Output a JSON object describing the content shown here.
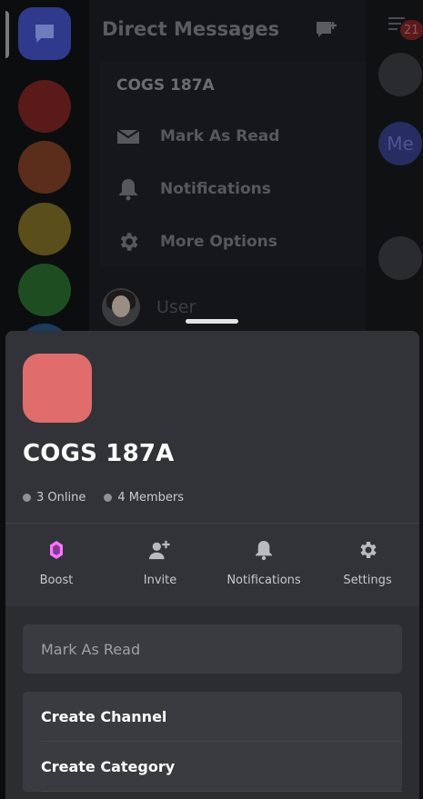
{
  "background": {
    "dm_title": "Direct Messages",
    "unread_badge": "21",
    "context_menu": {
      "title": "COGS 187A",
      "items": [
        {
          "label": "Mark As Read",
          "icon": "envelope-icon"
        },
        {
          "label": "Notifications",
          "icon": "bell-icon"
        },
        {
          "label": "More Options",
          "icon": "gear-icon"
        }
      ]
    },
    "dm_user": "User",
    "me_avatar_text": "Me",
    "rail_colors": [
      "#5a1a1a",
      "#5a2e1a",
      "#5a4f1a",
      "#1f4d22"
    ]
  },
  "sheet": {
    "guild_name": "COGS 187A",
    "guild_color": "#e06c6b",
    "online": "3 Online",
    "members": "4 Members",
    "actions": [
      {
        "label": "Boost",
        "icon": "boost-gem-icon"
      },
      {
        "label": "Invite",
        "icon": "add-user-icon"
      },
      {
        "label": "Notifications",
        "icon": "bell-icon"
      },
      {
        "label": "Settings",
        "icon": "gear-icon"
      }
    ],
    "mark_as_read": "Mark As Read",
    "create_channel": "Create Channel",
    "create_category": "Create Category"
  }
}
